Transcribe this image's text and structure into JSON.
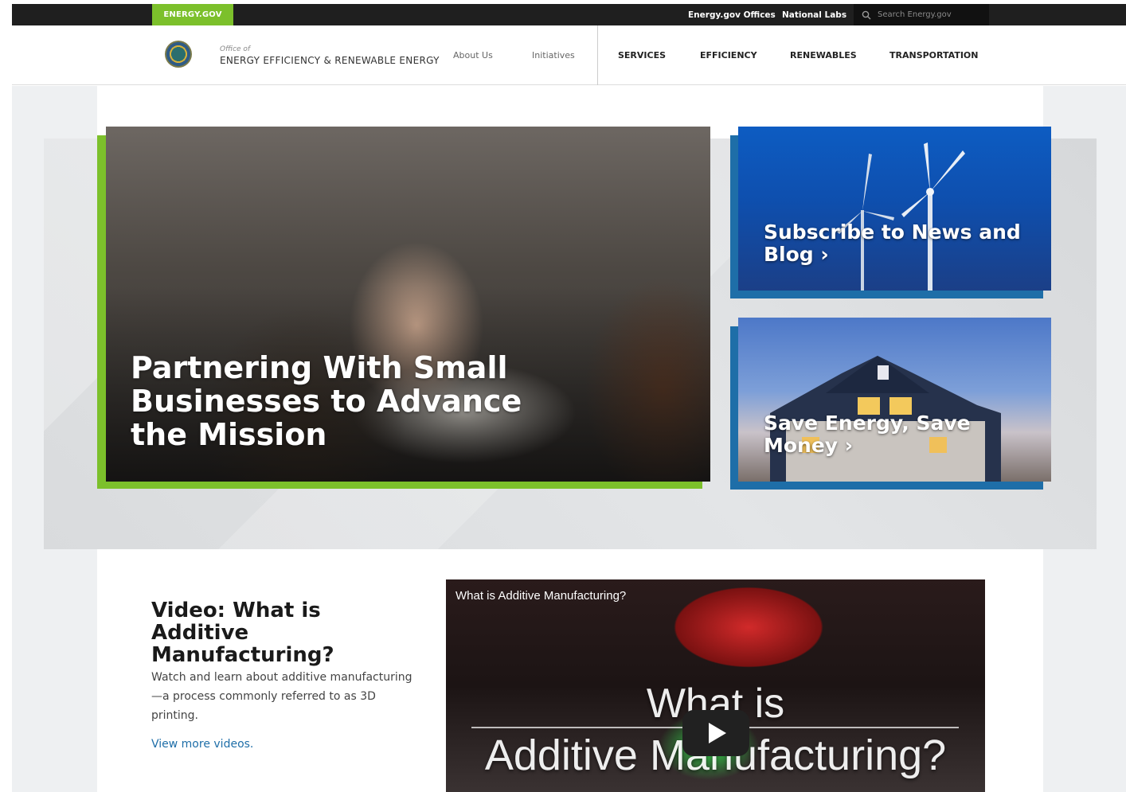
{
  "utility_bar": {
    "home_link": "ENERGY.GOV",
    "offices_link": "Energy.gov Offices",
    "labs_link": "National Labs",
    "search_placeholder": "Search Energy.gov"
  },
  "header": {
    "office_of": "Office of",
    "office_name": "ENERGY EFFICIENCY & RENEWABLE ENERGY",
    "secondary_nav": [
      "About Us",
      "Initiatives"
    ],
    "main_nav": [
      "SERVICES",
      "EFFICIENCY",
      "RENEWABLES",
      "TRANSPORTATION"
    ]
  },
  "hero": {
    "main_feature_title": "Partnering With Small Businesses to Advance the Mission",
    "cards": [
      {
        "title": "Subscribe to News and Blog ›"
      },
      {
        "title": "Save Energy, Save Money ›"
      }
    ]
  },
  "video_section": {
    "heading": "Video: What is Additive Manufacturing?",
    "description": "Watch and learn about additive manufacturing—a process commonly referred to as 3D printing.",
    "more_link": "View more videos.",
    "video_title": "What is Additive Manufacturing?",
    "overlay_line1": "What is",
    "overlay_line2": "Additive Manufacturing?"
  },
  "colors": {
    "accent_green": "#7cc02b",
    "accent_blue": "#1e6ea8",
    "utility_bar": "#1f1f1f"
  }
}
